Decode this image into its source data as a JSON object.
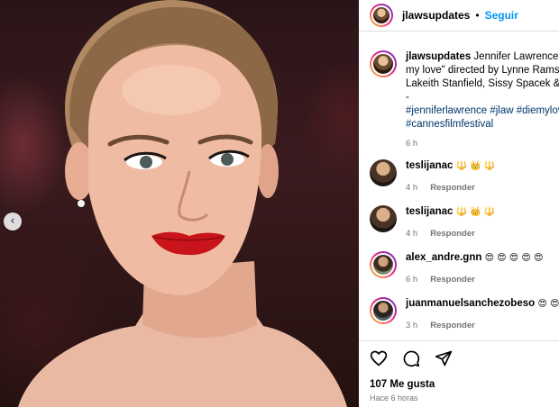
{
  "post": {
    "username": "jlawsupdates",
    "follow_label": "Seguir",
    "dot": "•",
    "caption_line1": "Jennifer Lawrence atte",
    "caption_line2": "my love\" directed by Lynne Ramsay,",
    "caption_line3": "Lakeith Stanfield, Sissy Spacek & Nic",
    "caption_line4": "-",
    "hashtags_line1": "#jenniferlawrence #jlaw #diemylove",
    "hashtags_line2": "#cannesfilmfestival",
    "caption_time": "6 h",
    "likes": "107 Me gusta",
    "posted_ago": "Hace 6 horas"
  },
  "comments": [
    {
      "username": "teslijanac",
      "text": "🔱 👑 🔱",
      "time": "4 h",
      "reply": "Responder"
    },
    {
      "username": "teslijanac",
      "text": "🔱 👑 🔱",
      "time": "4 h",
      "reply": "Responder"
    },
    {
      "username": "alex_andre.gnn",
      "text": "😍 😍 😍 😍 😍",
      "time": "6 h",
      "reply": "Responder"
    },
    {
      "username": "juanmanuelsanchezobeso",
      "text": "😍 😍 ❤",
      "time": "3 h",
      "reply": "Responder"
    }
  ],
  "icons": {
    "photo_prev": "chevron-left-icon",
    "like": "heart-icon",
    "comment": "comment-icon",
    "share": "share-icon"
  },
  "colors": {
    "accent": "#0095f6",
    "hashtag": "#00376b",
    "muted": "#737373",
    "border": "#dbdbdb"
  },
  "nav": {
    "prev_glyph": "‹"
  }
}
